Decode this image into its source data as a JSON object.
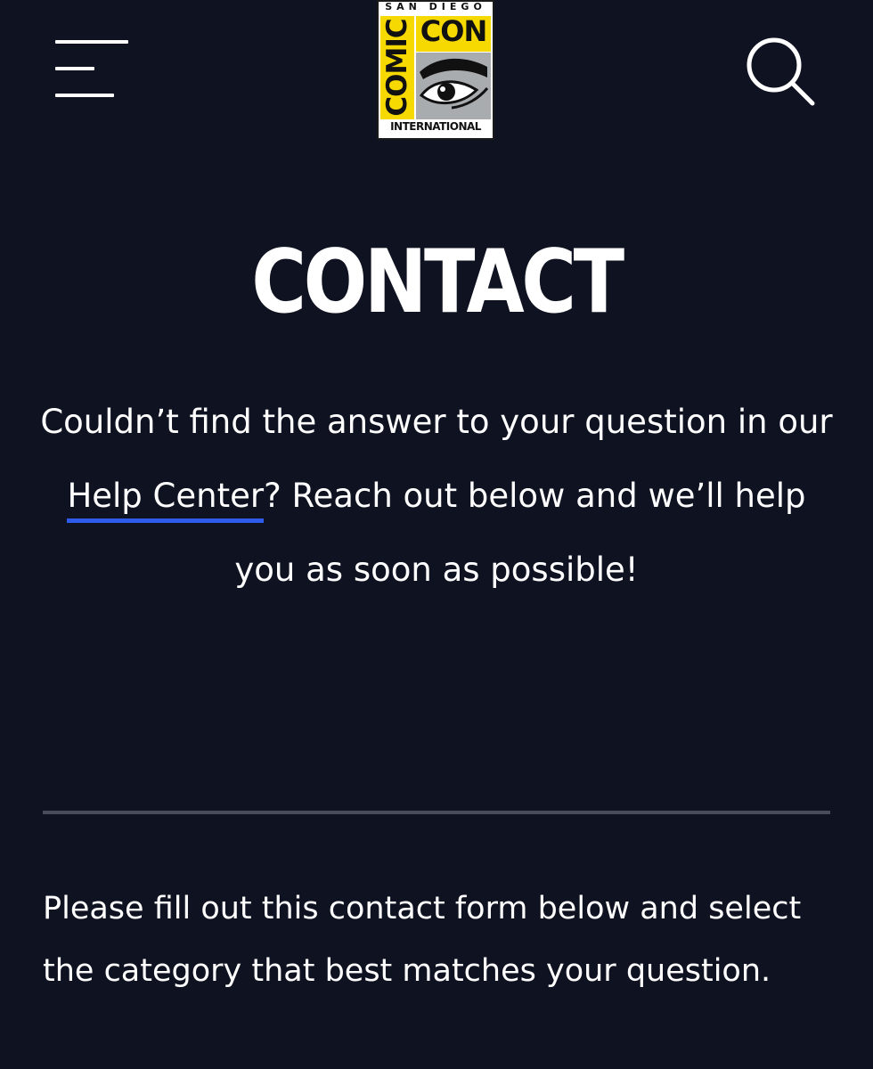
{
  "header": {
    "menu_icon": "hamburger-menu-icon",
    "search_icon": "search-icon",
    "logo": {
      "top_text": "SAN DIEGO",
      "comic_text": "COMIC",
      "con_text": "CON",
      "bottom_text": "INTERNATIONAL",
      "colors": {
        "yellow": "#f5d900",
        "gray": "#a9acaf",
        "ink": "#111111"
      }
    }
  },
  "page": {
    "title": "CONTACT",
    "intro_before_link": "Couldn’t find the answer to your question in our ",
    "help_link_label": "Help Center",
    "intro_after_link": "? Reach out below and we’ll help you as soon as possible!",
    "form_intro": "Please fill out this contact form below and select the category that best matches your question."
  },
  "colors": {
    "background": "#0f1221",
    "text": "#ffffff",
    "link_underline": "#2e5bea",
    "divider": "#4a4c5c"
  }
}
